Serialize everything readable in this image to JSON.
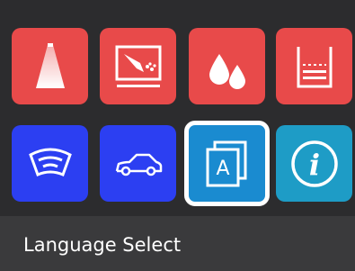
{
  "tiles": [
    {
      "id": "light-beam",
      "icon": "light-beam-icon",
      "color": "#e84a4a",
      "selected": false
    },
    {
      "id": "screen-spray",
      "icon": "washer-screen-icon",
      "color": "#e84a4a",
      "selected": false
    },
    {
      "id": "droplets",
      "icon": "droplets-icon",
      "color": "#e84a4a",
      "selected": false
    },
    {
      "id": "fluid-level",
      "icon": "fluid-level-icon",
      "color": "#e84a4a",
      "selected": false
    },
    {
      "id": "windshield",
      "icon": "windshield-icon",
      "color": "#2c3ff2",
      "selected": false
    },
    {
      "id": "car",
      "icon": "car-icon",
      "color": "#2c3ff2",
      "selected": false
    },
    {
      "id": "language",
      "icon": "language-icon",
      "color": "#1a8bd0",
      "selected": true,
      "letter": "A"
    },
    {
      "id": "info",
      "icon": "info-icon",
      "color": "#1e9cc6",
      "selected": false,
      "glyph": "i"
    }
  ],
  "footer": {
    "label": "Language Select"
  }
}
